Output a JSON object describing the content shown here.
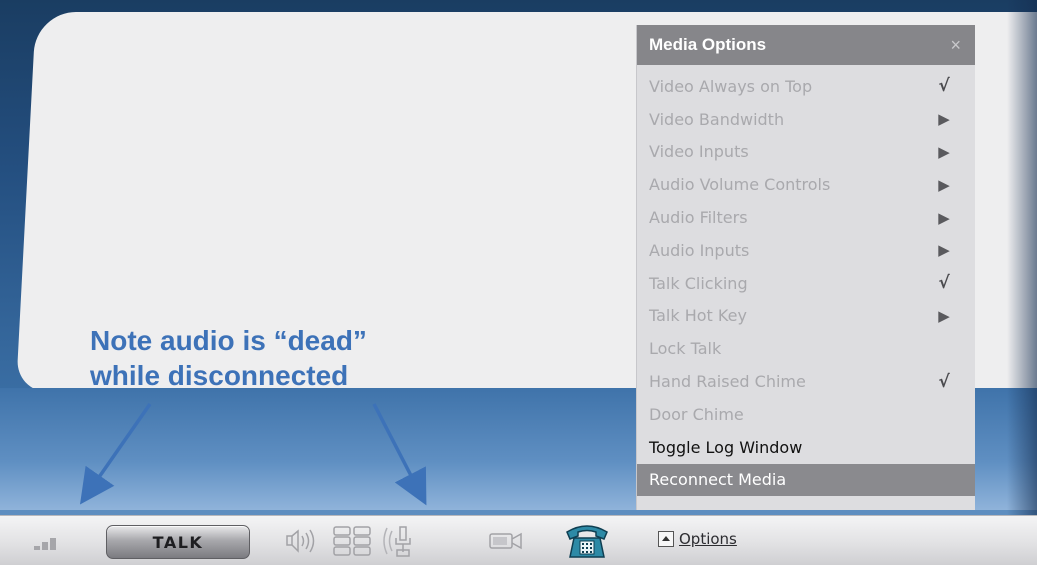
{
  "annotation": {
    "line1": "Note audio is “dead”",
    "line2": "while disconnected",
    "color": "#3d72b8"
  },
  "media_menu": {
    "title": "Media Options",
    "close_label": "×",
    "items": [
      {
        "label": "Video Always on Top",
        "marker": "√",
        "marker_type": "check",
        "enabled": false
      },
      {
        "label": "Video Bandwidth",
        "marker": "▶",
        "marker_type": "submenu",
        "enabled": false
      },
      {
        "label": "Video Inputs",
        "marker": "▶",
        "marker_type": "submenu",
        "enabled": false
      },
      {
        "label": "Audio Volume Controls",
        "marker": "▶",
        "marker_type": "submenu",
        "enabled": false
      },
      {
        "label": "Audio Filters",
        "marker": "▶",
        "marker_type": "submenu",
        "enabled": false
      },
      {
        "label": "Audio Inputs",
        "marker": "▶",
        "marker_type": "submenu",
        "enabled": false
      },
      {
        "label": "Talk Clicking",
        "marker": "√",
        "marker_type": "check",
        "enabled": false
      },
      {
        "label": "Talk Hot Key",
        "marker": "▶",
        "marker_type": "submenu",
        "enabled": false
      },
      {
        "label": "Lock Talk",
        "marker": "",
        "marker_type": "none",
        "enabled": false
      },
      {
        "label": "Hand Raised Chime",
        "marker": "√",
        "marker_type": "check",
        "enabled": false
      },
      {
        "label": "Door Chime",
        "marker": "",
        "marker_type": "none",
        "enabled": false
      },
      {
        "label": "Toggle Log Window",
        "marker": "",
        "marker_type": "none",
        "enabled": true
      },
      {
        "label": "Reconnect Media",
        "marker": "",
        "marker_type": "none",
        "enabled": true,
        "active": true
      }
    ]
  },
  "toolbar": {
    "talk_label": "TALK",
    "options_label": "Options",
    "icons": [
      "signal-strength-icon",
      "speaker-icon",
      "equalizer-icon",
      "microphone-icon",
      "video-camera-icon",
      "telephone-icon",
      "options-toggle-icon"
    ]
  }
}
